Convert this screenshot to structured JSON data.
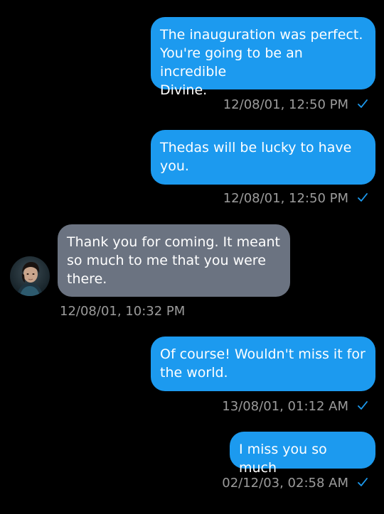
{
  "colors": {
    "background": "#000000",
    "sent_bubble": "#1c9aef",
    "received_bubble": "#6b7381",
    "timestamp": "#9b9b9b",
    "read_check": "#1c9aef"
  },
  "messages": [
    {
      "direction": "sent",
      "text": "The inauguration was perfect.\nYou're going to be an incredible\nDivine.",
      "time": "12/08/01, 12:50 PM",
      "status_icon": "check-icon"
    },
    {
      "direction": "sent",
      "text": "Thedas will be lucky to have\nyou.",
      "time": "12/08/01, 12:50 PM",
      "status_icon": "check-icon"
    },
    {
      "direction": "received",
      "text": "Thank you for coming. It meant\nso much to me that you were\nthere.",
      "time": "12/08/01, 10:32 PM",
      "avatar_icon": "contact-avatar"
    },
    {
      "direction": "sent",
      "text": "Of course! Wouldn't miss it for\nthe world.",
      "time": "13/08/01, 01:12 AM",
      "status_icon": "check-icon"
    },
    {
      "direction": "sent",
      "text": "I miss you so much",
      "time": "02/12/03, 02:58 AM",
      "status_icon": "check-icon"
    }
  ]
}
